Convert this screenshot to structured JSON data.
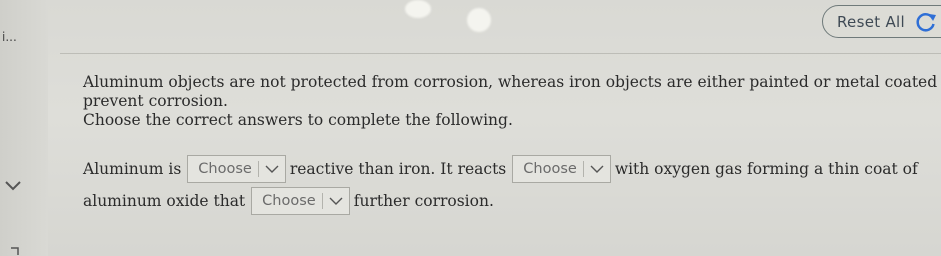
{
  "header": {
    "breadcrumb_stub": "i...",
    "reset_label": "Reset All"
  },
  "question": {
    "intro_line1": "Aluminum objects are not protected from corrosion, whereas iron objects are either painted or metal coated to",
    "intro_line2": "prevent corrosion.",
    "instruction": "Choose the correct answers to complete the following.",
    "sentence": {
      "part1": "Aluminum is",
      "part2": "reactive than iron. It reacts",
      "part3": "with oxygen gas forming a thin coat of",
      "part4": "aluminum oxide that",
      "part5": "further corrosion."
    },
    "dropdowns": [
      {
        "selected": "Choose"
      },
      {
        "selected": "Choose"
      },
      {
        "selected": "Choose"
      }
    ]
  },
  "icons": {
    "reset": "refresh-icon",
    "dropdown": "chevron-down-icon",
    "side": "chevron-down-icon"
  },
  "colors": {
    "background": "#dcdcd7",
    "reset_border": "#6f7a7a",
    "reset_icon": "#2f6fd6"
  }
}
